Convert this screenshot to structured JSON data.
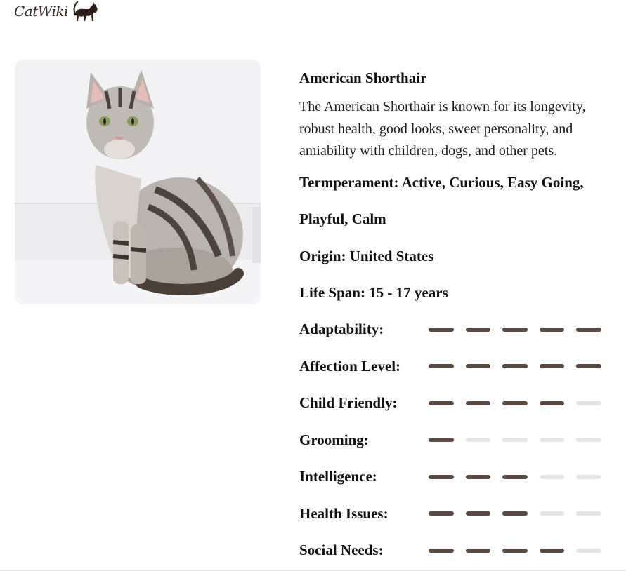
{
  "logo": {
    "text": "CatWiki",
    "icon": "cat-silhouette-icon"
  },
  "breed": {
    "name": "American Shorthair",
    "description": "The American Shorthair is known for its longevity, robust health, good looks, sweet personality, and amiability with children, dogs, and other pets.",
    "temperament": "Termperament: Active, Curious, Easy Going, Playful, Calm",
    "origin": "Origin: United States",
    "life_span": "Life Span: 15 - 17 years"
  },
  "ratings": [
    {
      "label": "Adaptability:",
      "value": 5,
      "max": 5
    },
    {
      "label": "Affection Level:",
      "value": 5,
      "max": 5
    },
    {
      "label": "Child Friendly:",
      "value": 4,
      "max": 5
    },
    {
      "label": "Grooming:",
      "value": 1,
      "max": 5
    },
    {
      "label": "Intelligence:",
      "value": 3,
      "max": 5
    },
    {
      "label": "Health Issues:",
      "value": 3,
      "max": 5
    },
    {
      "label": "Social Needs:",
      "value": 4,
      "max": 5
    }
  ],
  "colors": {
    "bar_on": "#5a4a42",
    "bar_off": "#e4e4e4",
    "logo": "#3a2a22"
  }
}
